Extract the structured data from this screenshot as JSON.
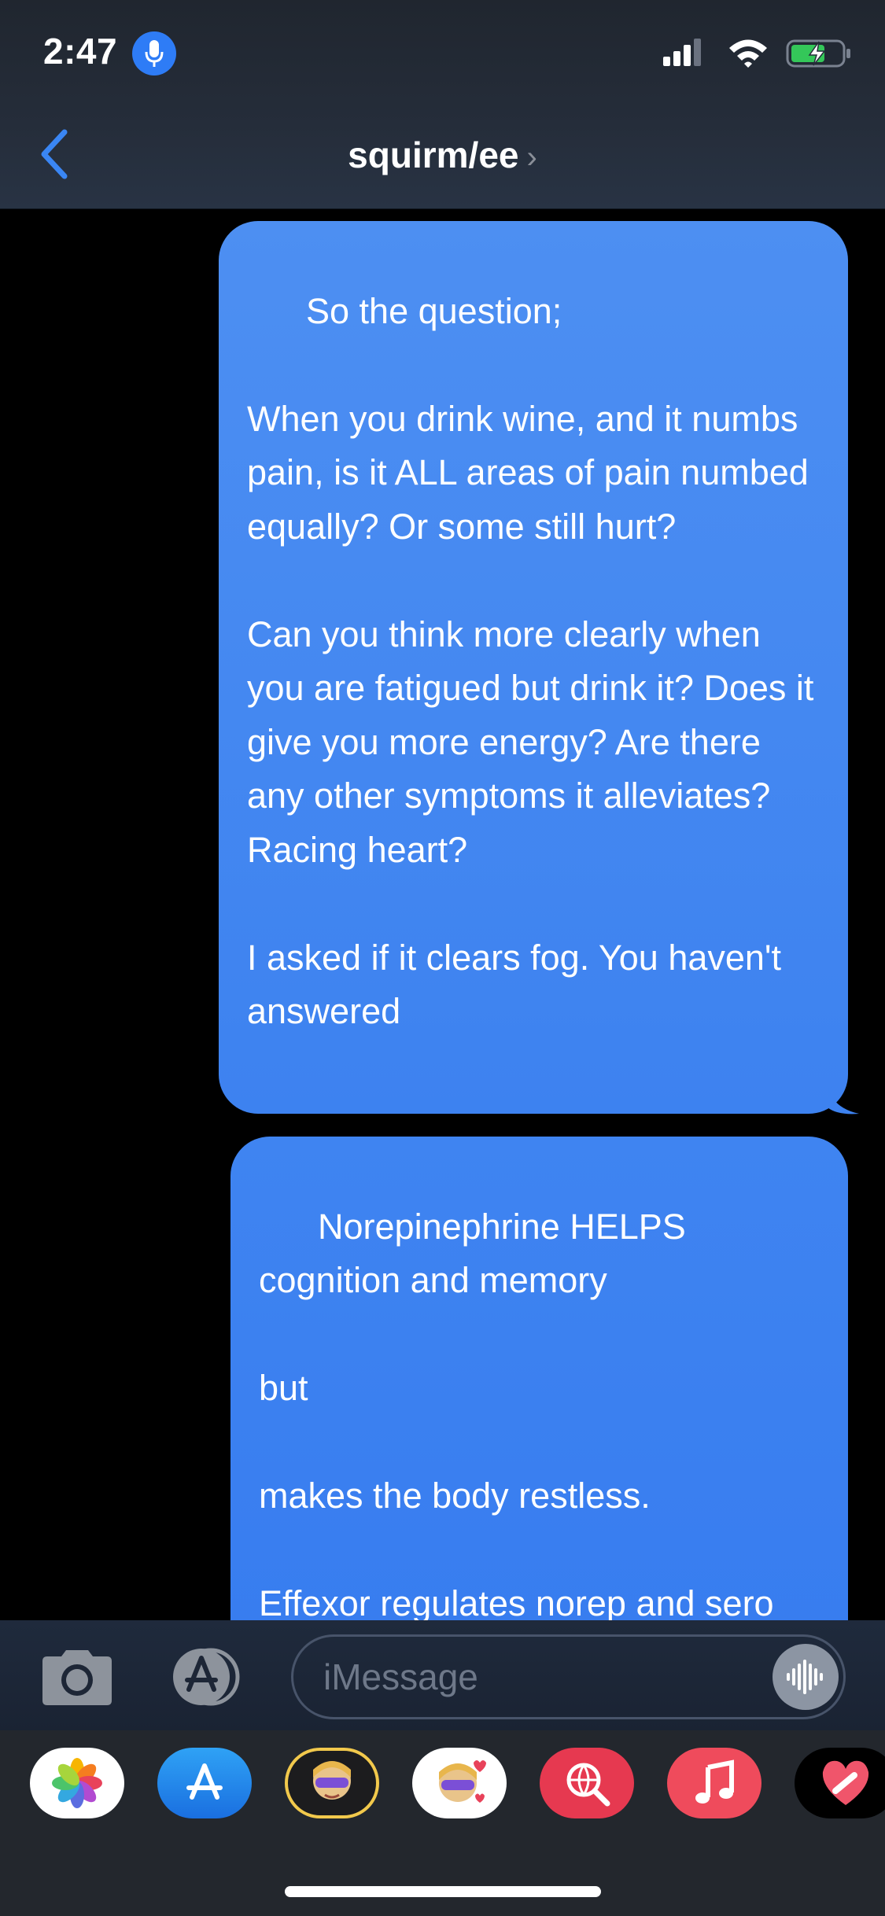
{
  "status_bar": {
    "time": "2:47",
    "mic_icon": "microphone-icon",
    "signal_icon": "cellular-signal-icon",
    "wifi_icon": "wifi-icon",
    "battery_icon": "battery-charging-icon"
  },
  "header": {
    "back_icon": "chevron-left-icon",
    "contact_name": "squirm/ee",
    "chevron": "›"
  },
  "messages": [
    {
      "sender": "me",
      "text": "So the question;\n\nWhen you drink wine, and it numbs pain, is it ALL areas of pain numbed equally? Or some still hurt?\n\nCan you think more clearly when you are fatigued but drink it? Does it give you more energy? Are there any other symptoms it alleviates? Racing heart?\n\nI asked if it clears fog. You haven't answered"
    },
    {
      "sender": "me",
      "text": "Norepinephrine HELPS cognition and memory\n\nbut\n\nmakes the body restless.\n\nEffexor regulates norep and sero"
    }
  ],
  "input_bar": {
    "camera_icon": "camera-icon",
    "apps_icon": "app-store-icon",
    "placeholder": "iMessage",
    "audio_icon": "audio-waveform-icon"
  },
  "app_drawer": {
    "apps": [
      "photos-app-icon",
      "app-store-app-icon",
      "memoji-camera-app-icon",
      "memoji-stickers-app-icon",
      "web-search-app-icon",
      "music-app-icon",
      "digital-touch-app-icon"
    ]
  },
  "colors": {
    "bubble_blue": "#3d82f0",
    "header_bg": "#252d3a",
    "accent": "#2e7cf6"
  }
}
